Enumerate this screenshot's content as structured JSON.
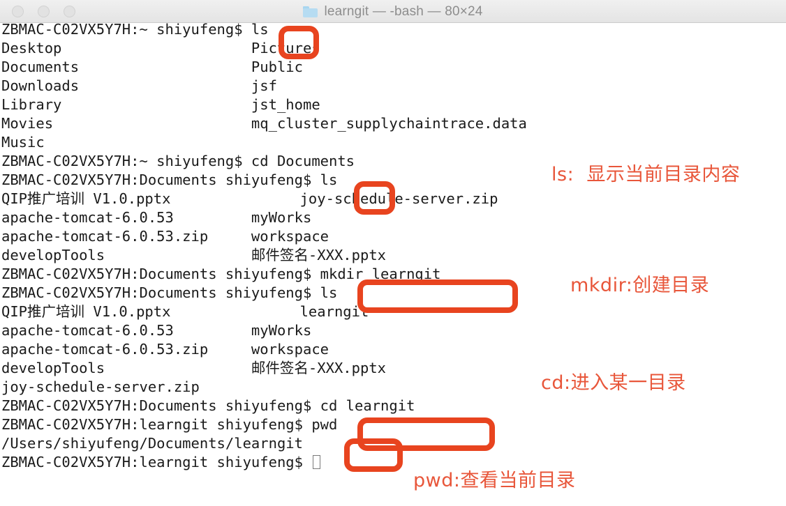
{
  "window": {
    "title": "learngit — -bash — 80×24",
    "folder_icon": "folder-icon",
    "buttons": {
      "close": "close-button",
      "minimize": "minimize-button",
      "maximize": "maximize-button"
    }
  },
  "accent_color": "#e8441f",
  "annotation_color": "#e8563a",
  "terminal": {
    "lines": [
      {
        "text": "ZBMAC-C02VX5Y7H:~ shiyufeng$ ls"
      },
      {
        "text": "Desktop                      Pictures"
      },
      {
        "text": "Documents                    Public"
      },
      {
        "text": "Downloads                    jsf"
      },
      {
        "text": "Library                      jst_home"
      },
      {
        "text": "Movies                       mq_cluster_supplychaintrace.data"
      },
      {
        "text": "Music"
      },
      {
        "text": "ZBMAC-C02VX5Y7H:~ shiyufeng$ cd Documents"
      },
      {
        "text": "ZBMAC-C02VX5Y7H:Documents shiyufeng$ ls"
      },
      {
        "text": "QIP推广培训 V1.0.pptx               joy-schedule-server.zip",
        "has_cjk": true
      },
      {
        "text": "apache-tomcat-6.0.53         myWorks"
      },
      {
        "text": "apache-tomcat-6.0.53.zip     workspace"
      },
      {
        "text": "developTools                 邮件签名-XXX.pptx",
        "has_cjk": true
      },
      {
        "text": "ZBMAC-C02VX5Y7H:Documents shiyufeng$ mkdir learngit"
      },
      {
        "text": "ZBMAC-C02VX5Y7H:Documents shiyufeng$ ls"
      },
      {
        "text": "QIP推广培训 V1.0.pptx               learngit",
        "has_cjk": true
      },
      {
        "text": "apache-tomcat-6.0.53         myWorks"
      },
      {
        "text": "apache-tomcat-6.0.53.zip     workspace"
      },
      {
        "text": "developTools                 邮件签名-XXX.pptx",
        "has_cjk": true
      },
      {
        "text": "joy-schedule-server.zip"
      },
      {
        "text": "ZBMAC-C02VX5Y7H:Documents shiyufeng$ cd learngit"
      },
      {
        "text": "ZBMAC-C02VX5Y7H:learngit shiyufeng$ pwd"
      },
      {
        "text": "/Users/shiyufeng/Documents/learngit"
      },
      {
        "text": "ZBMAC-C02VX5Y7H:learngit shiyufeng$ "
      }
    ]
  },
  "highlights": [
    {
      "name": "ls-command-1",
      "label": "ls"
    },
    {
      "name": "ls-command-2",
      "label": "ls"
    },
    {
      "name": "mkdir-command",
      "label": "mkdir learngit"
    },
    {
      "name": "cd-command",
      "label": "cd learngit"
    },
    {
      "name": "pwd-command",
      "label": "pwd"
    }
  ],
  "annotations": [
    {
      "name": "annotation-ls",
      "text": "ls:  显示当前目录内容"
    },
    {
      "name": "annotation-mkdir",
      "text": "mkdir:创建目录"
    },
    {
      "name": "annotation-cd",
      "text": "cd:进入某一目录"
    },
    {
      "name": "annotation-pwd",
      "text": "pwd:查看当前目录"
    }
  ]
}
